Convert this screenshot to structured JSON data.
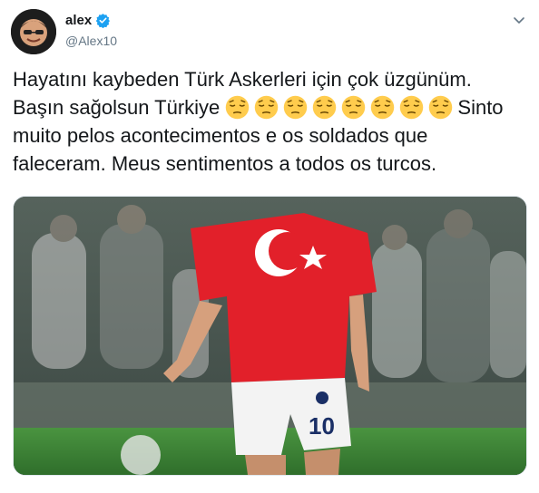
{
  "user": {
    "display_name": "alex",
    "handle": "@Alex10",
    "verified": true,
    "avatar_icon": "user-avatar"
  },
  "menu": {
    "icon": "chevron-down-icon"
  },
  "tweet": {
    "line1": "Hayatını kaybeden Türk Askerleri için çok üzgünüm.",
    "line2_before": "Başın sağolsun Türkiye ",
    "emoji_name": "pensive-face-emoji",
    "emoji_count": 8,
    "line2_after": "Sinto",
    "rest": "muito pelos acontecimentos e os soldados que faleceram. Meus sentimentos a todos os turcos."
  },
  "media": {
    "type": "photo",
    "description_icon": "football-player-photo",
    "jersey_number": "10"
  },
  "colors": {
    "accent": "#1da1f2",
    "jersey": "#e2202a",
    "pitch": "#3f8a3a",
    "emoji": "#ffcc4d"
  }
}
